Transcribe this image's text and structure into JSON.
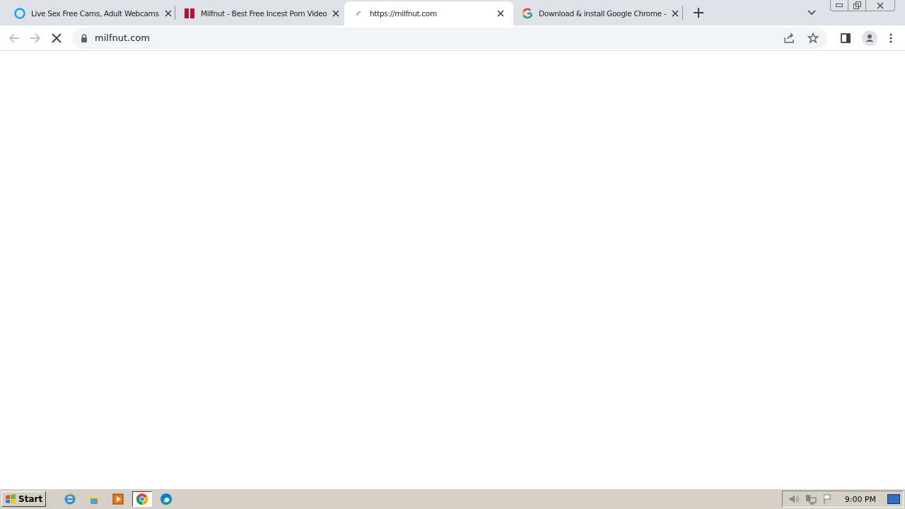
{
  "tabs": [
    {
      "title": "Live Sex Free Cams, Adult Webcams",
      "kind": "ring",
      "selected": false
    },
    {
      "title": "Milfnut - Best Free Incest Porn Video",
      "kind": "bars",
      "selected": false
    },
    {
      "title": "https://milfnut.com",
      "kind": "loading",
      "selected": true
    },
    {
      "title": "Download & install Google Chrome -",
      "kind": "g",
      "selected": false
    }
  ],
  "toolbar": {
    "loading": true,
    "address": "milfnut.com"
  },
  "taskbar": {
    "start": "Start",
    "apps": [
      {
        "kind": "ie",
        "selected": false
      },
      {
        "kind": "explorer",
        "selected": false
      },
      {
        "kind": "media",
        "selected": false
      },
      {
        "kind": "chrome",
        "selected": true
      },
      {
        "kind": "edge",
        "selected": false
      }
    ],
    "clock": "9:00 PM"
  }
}
